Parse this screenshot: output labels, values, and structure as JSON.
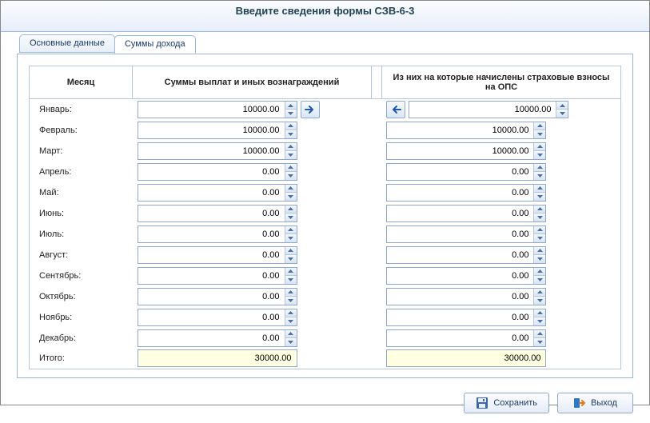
{
  "title": "Введите сведения формы СЗВ-6-3",
  "tabs": {
    "main": "Основные данные",
    "sums": "Суммы дохода"
  },
  "headers": {
    "month": "Месяц",
    "payments": "Суммы выплат и иных вознаграждений",
    "insurance": "Из них на которые начислены страховые взносы на ОПС"
  },
  "months": [
    {
      "label": "Январь:",
      "pay": "10000.00",
      "ins": "10000.00"
    },
    {
      "label": "Февраль:",
      "pay": "10000.00",
      "ins": "10000.00"
    },
    {
      "label": "Март:",
      "pay": "10000.00",
      "ins": "10000.00"
    },
    {
      "label": "Апрель:",
      "pay": "0.00",
      "ins": "0.00"
    },
    {
      "label": "Май:",
      "pay": "0.00",
      "ins": "0.00"
    },
    {
      "label": "Июнь:",
      "pay": "0.00",
      "ins": "0.00"
    },
    {
      "label": "Июль:",
      "pay": "0.00",
      "ins": "0.00"
    },
    {
      "label": "Август:",
      "pay": "0.00",
      "ins": "0.00"
    },
    {
      "label": "Сентябрь:",
      "pay": "0.00",
      "ins": "0.00"
    },
    {
      "label": "Октябрь:",
      "pay": "0.00",
      "ins": "0.00"
    },
    {
      "label": "Ноябрь:",
      "pay": "0.00",
      "ins": "0.00"
    },
    {
      "label": "Декабрь:",
      "pay": "0.00",
      "ins": "0.00"
    }
  ],
  "total": {
    "label": "Итого:",
    "pay": "30000.00",
    "ins": "30000.00"
  },
  "buttons": {
    "save": "Сохранить",
    "exit": "Выход"
  }
}
